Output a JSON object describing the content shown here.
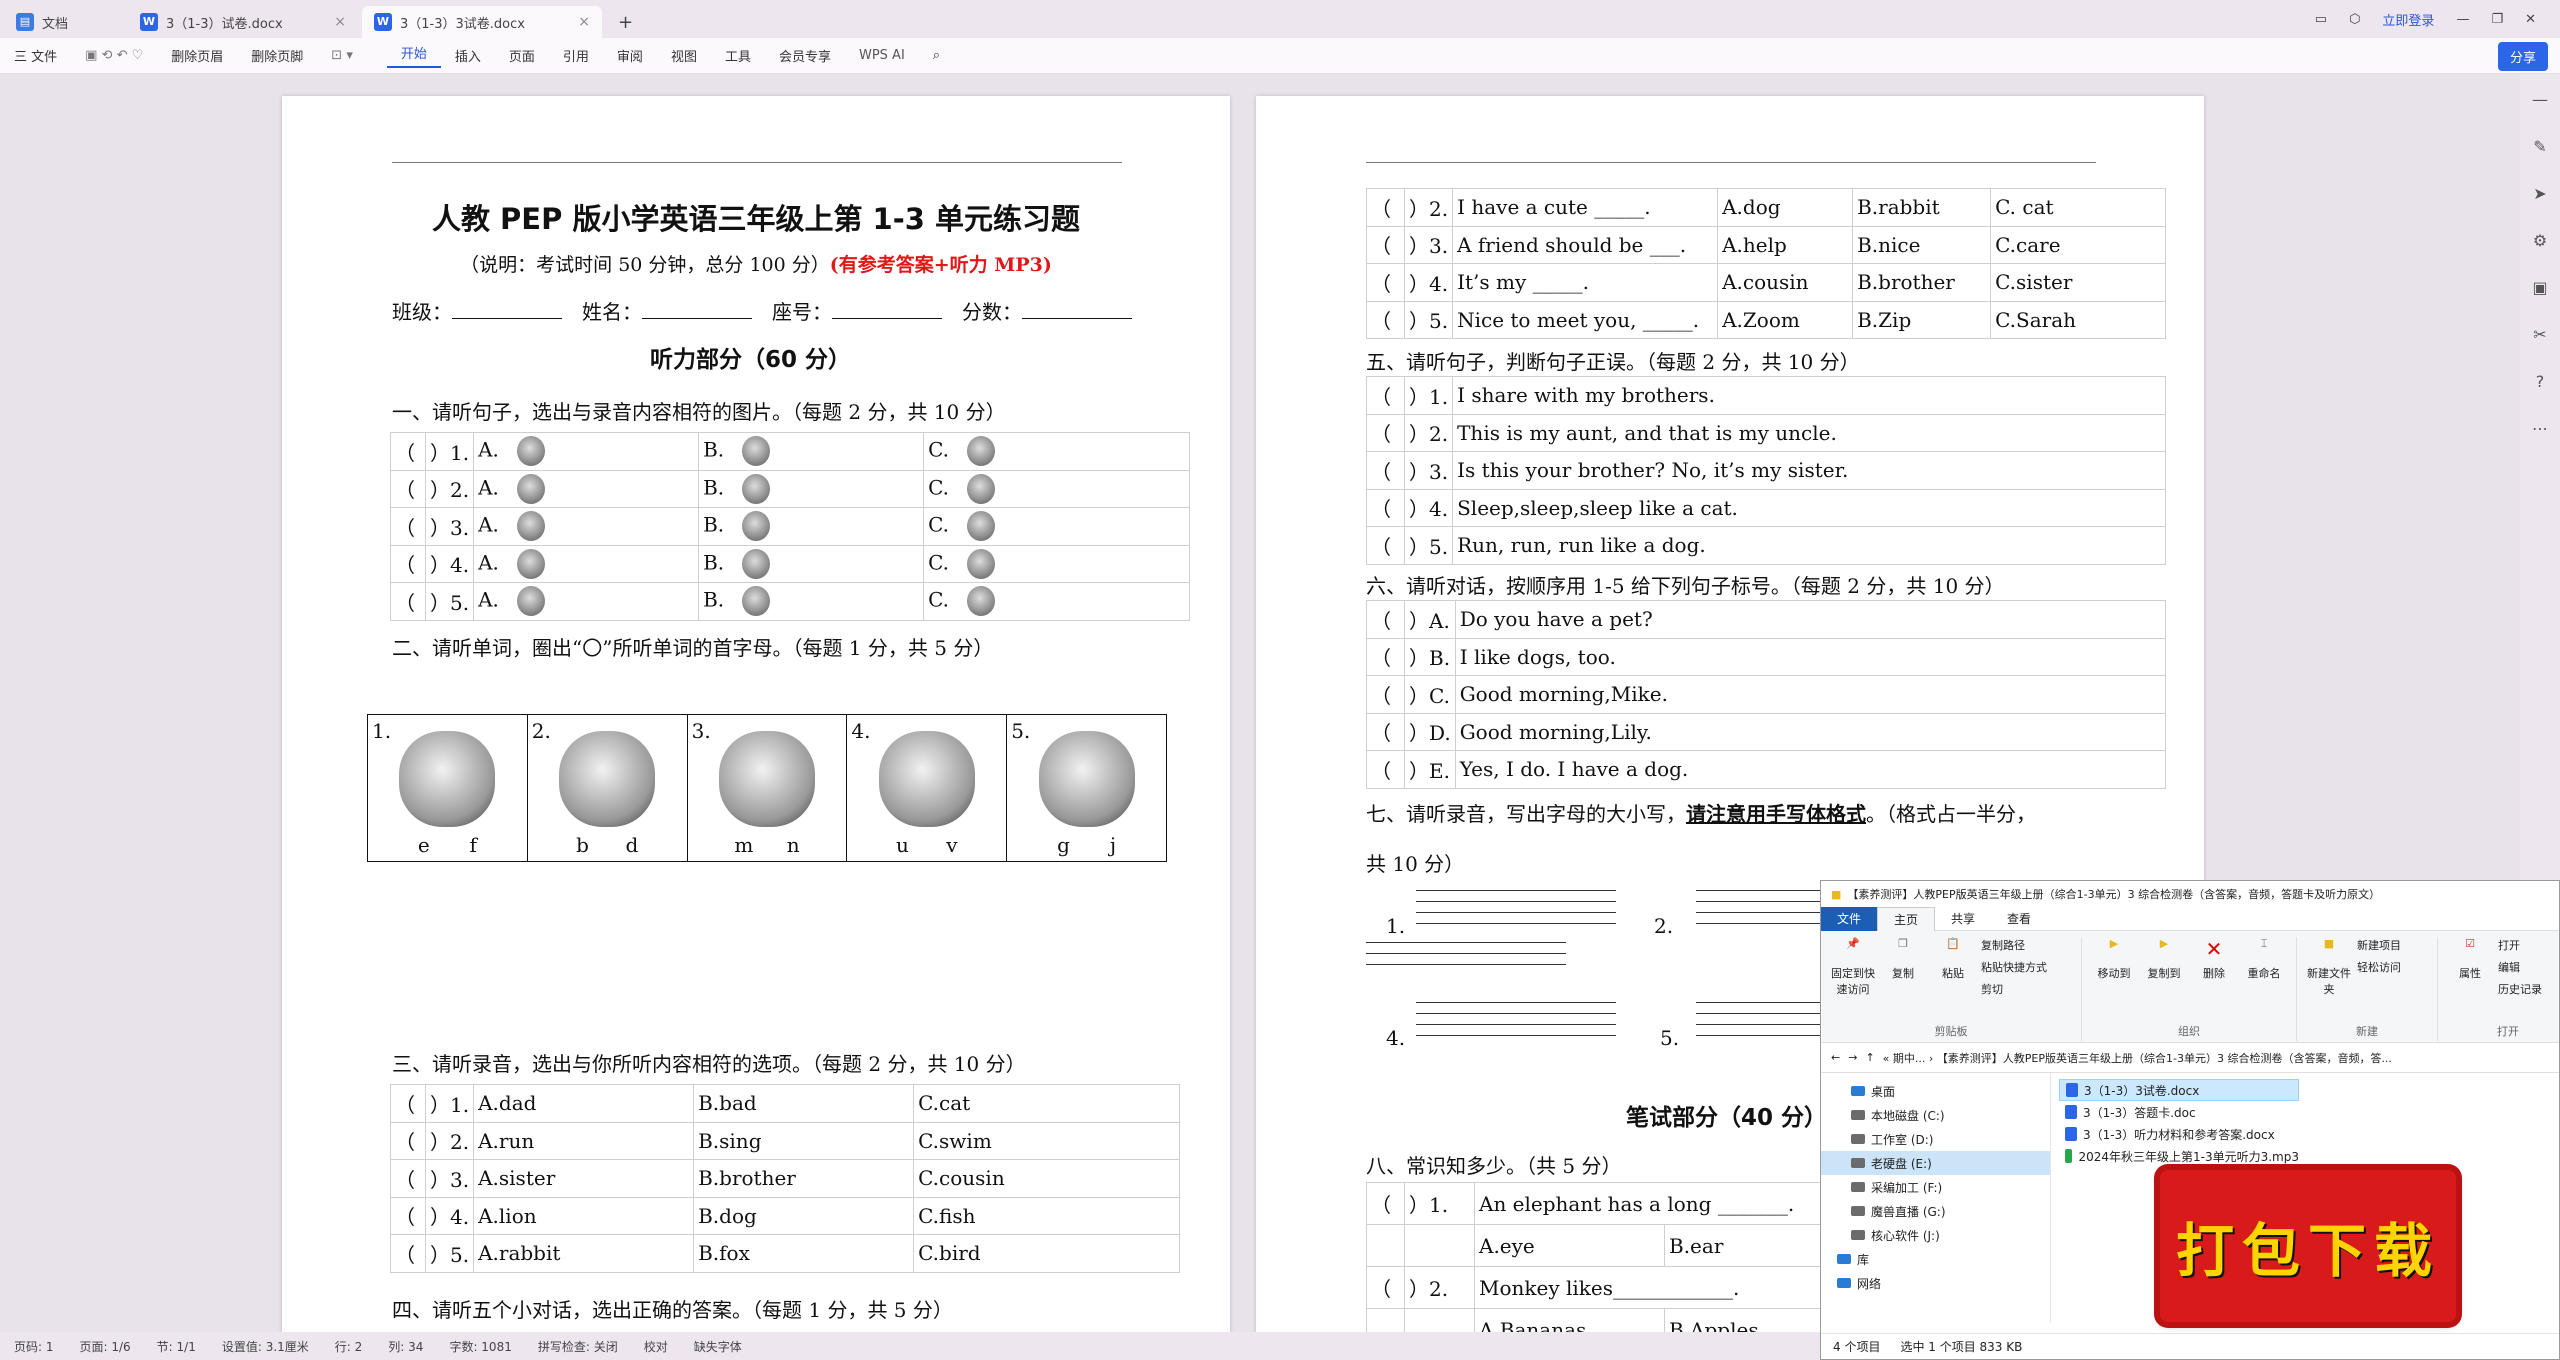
{
  "tabs": [
    {
      "label": "文档",
      "icon": "doc-home-icon"
    },
    {
      "label": "3（1-3）试卷.docx",
      "icon": "word-icon"
    },
    {
      "label": "3（1-3）3试卷.docx",
      "icon": "word-icon"
    }
  ],
  "topbar": {
    "login": "立即登录",
    "add": "+"
  },
  "menu": {
    "file": "三 文件",
    "undo_label": "删除页眉",
    "del_footer": "删除页脚",
    "items": [
      "开始",
      "插入",
      "页面",
      "引用",
      "审阅",
      "视图",
      "工具",
      "会员专享"
    ],
    "ai": "WPS AI",
    "share": "分享"
  },
  "left_page": {
    "title": "人教 PEP 版小学英语三年级上第 1-3 单元练习题",
    "note": "（说明：考试时间 50 分钟，总分 100 分）",
    "note_red": "(有参考答案+听力 MP3)",
    "info": [
      "班级：",
      "姓名：",
      "座号：",
      "分数："
    ],
    "listening_head": "听力部分（60 分）",
    "q1_head": "一、请听句子，选出与录音内容相符的图片。（每题 2 分，共 10 分）",
    "q1_rows": [
      [
        "（",
        "）1.",
        "A.",
        "B.",
        "C."
      ],
      [
        "（",
        "）2.",
        "A.",
        "B.",
        "C."
      ],
      [
        "（",
        "）3.",
        "A.",
        "B.",
        "C."
      ],
      [
        "（",
        "）4.",
        "A.",
        "B.",
        "C."
      ],
      [
        "（",
        "）5.",
        "A.",
        "B.",
        "C."
      ]
    ],
    "q2_head": "二、请听单词，圈出“〇”所听单词的首字母。（每题 1 分，共 5 分）",
    "q2_cells": [
      {
        "n": "1.",
        "a": "e",
        "b": "f"
      },
      {
        "n": "2.",
        "a": "b",
        "b": "d"
      },
      {
        "n": "3.",
        "a": "m",
        "b": "n"
      },
      {
        "n": "4.",
        "a": "u",
        "b": "v"
      },
      {
        "n": "5.",
        "a": "g",
        "b": "j"
      }
    ],
    "q3_head": "三、请听录音，选出与你所听内容相符的选项。（每题 2 分，共 10 分）",
    "q3_rows": [
      [
        "（",
        "）1.",
        "A.dad",
        "B.bad",
        "C.cat"
      ],
      [
        "（",
        "）2.",
        "A.run",
        "B.sing",
        "C.swim"
      ],
      [
        "（",
        "）3.",
        "A.sister",
        "B.brother",
        "C.cousin"
      ],
      [
        "（",
        "）4.",
        "A.lion",
        "B.dog",
        "C.fish"
      ],
      [
        "（",
        "）5.",
        "A.rabbit",
        "B.fox",
        "C.bird"
      ]
    ],
    "q4_head": "四、请听五个小对话，选出正确的答案。（每题 1 分，共 5 分）"
  },
  "right_page": {
    "q4_rows": [
      [
        "（",
        "）2.",
        "I have a cute _____.",
        "A.dog",
        "B.rabbit",
        "C. cat"
      ],
      [
        "（",
        "）3.",
        "A friend should be ___.",
        "A.help",
        "B.nice",
        "C.care"
      ],
      [
        "（",
        "）4.",
        "It’s my _____.",
        "A.cousin",
        "B.brother",
        "C.sister"
      ],
      [
        "（",
        "）5.",
        "Nice to meet you, _____.",
        "A.Zoom",
        "B.Zip",
        "C.Sarah"
      ]
    ],
    "q5_head": "五、请听句子，判断句子正误。（每题 2 分，共 10 分）",
    "q5_rows": [
      [
        "（",
        "）1.",
        "I share with my brothers."
      ],
      [
        "（",
        "）2.",
        "This is my aunt, and that is my uncle."
      ],
      [
        "（",
        "）3.",
        "Is this your brother? No, it’s my sister."
      ],
      [
        "（",
        "）4.",
        "Sleep,sleep,sleep like a cat."
      ],
      [
        "（",
        "）5.",
        "Run, run, run like a dog."
      ]
    ],
    "q6_head": "六、请听对话，按顺序用 1-5 给下列句子标号。（每题 2 分，共 10 分）",
    "q6_rows": [
      [
        "（",
        "）A.",
        "Do you have a pet?"
      ],
      [
        "（",
        "）B.",
        "I like dogs, too."
      ],
      [
        "（",
        "）C.",
        "Good morning,Mike."
      ],
      [
        "（",
        "）D.",
        "Good morning,Lily."
      ],
      [
        "（",
        "）E.",
        "Yes, I do. I have a dog."
      ]
    ],
    "q7_head_a": "七、请听录音，写出字母的大小写，",
    "q7_head_u": "请注意用手写体格式",
    "q7_head_b": "。（格式占一半分，",
    "q7_head_c": "共 10 分）",
    "q7_nums": [
      "1.",
      "2.",
      "4.",
      "5."
    ],
    "written_head": "笔试部分（40 分）",
    "q8_head": "八、常识知多少。（共 5 分）",
    "q8_r1": [
      "（",
      "）1.",
      "An elephant has a long _______."
    ],
    "q8_r1_opts": [
      "A.eye",
      "B.ear"
    ],
    "q8_r2": [
      "（",
      "）2.",
      "Monkey likes____________."
    ],
    "q8_r2_opts": [
      "A.Bananas",
      "B.Apples"
    ]
  },
  "statusbar": [
    "页码: 1",
    "页面: 1/6",
    "节: 1/1",
    "设置值: 3.1厘米",
    "行: 2",
    "列: 34",
    "字数: 1081",
    "拼写检查: 关闭",
    "校对",
    "缺失字体"
  ],
  "explorer": {
    "title": "【素养测评】人教PEP版英语三年级上册（综合1-3单元）3 综合检测卷（含答案，音频，答题卡及听力原文）",
    "tabs": [
      "文件",
      "主页",
      "共享",
      "查看"
    ],
    "groups": [
      {
        "label": "剪贴板",
        "buttons": [
          "固定到快速访问",
          "复制",
          "粘贴"
        ],
        "small": [
          "复制路径",
          "粘贴快捷方式",
          "剪切"
        ]
      },
      {
        "label": "组织",
        "buttons": [
          "移动到",
          "复制到",
          "删除",
          "重命名"
        ]
      },
      {
        "label": "新建",
        "buttons": [
          "新建文件夹"
        ],
        "small": [
          "新建项目",
          "轻松访问"
        ]
      },
      {
        "label": "打开",
        "buttons": [
          "属性"
        ],
        "small": [
          "打开",
          "编辑",
          "历史记录"
        ]
      }
    ],
    "address": "« 期中... › 【素养测评】人教PEP版英语三年级上册（综合1-3单元）3 综合检测卷（含答案，音频，答...",
    "nav": [
      "桌面",
      "本地磁盘 (C:)",
      "工作室 (D:)",
      "老硬盘 (E:)",
      "采编加工 (F:)",
      "魔兽直播 (G:)",
      "核心软件 (J:)",
      "库",
      "网络"
    ],
    "files": [
      "3（1-3）3试卷.docx",
      "3（1-3）答题卡.doc",
      "3（1-3）听力材料和参考答案.docx",
      "2024年秋三年级上第1-3单元听力3.mp3"
    ],
    "status": [
      "4 个项目",
      "选中 1 个项目  833 KB"
    ]
  },
  "download": "打包下载"
}
